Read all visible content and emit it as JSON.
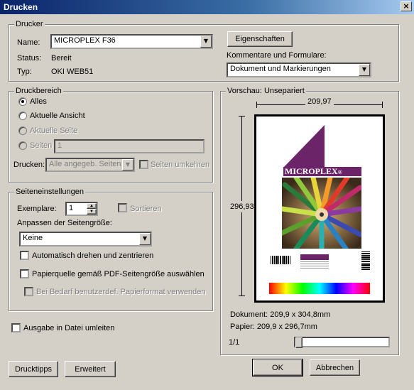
{
  "window": {
    "title": "Drucken",
    "close_glyph": "×"
  },
  "printer": {
    "group_title": "Drucker",
    "name_label": "Name:",
    "name_value": "MICROPLEX F36",
    "status_label": "Status:",
    "status_value": "Bereit",
    "type_label": "Typ:",
    "type_value": "OKI WEB51",
    "properties_button": "Eigenschaften",
    "comments_label": "Kommentare und Formulare:",
    "comments_value": "Dokument und Markierungen"
  },
  "print_range": {
    "group_title": "Druckbereich",
    "all_label": "Alles",
    "current_view_label": "Aktuelle Ansicht",
    "current_page_label": "Aktuelle Seite",
    "pages_label": "Seiten",
    "pages_value": "1",
    "print_label": "Drucken:",
    "print_value": "Alle angegeb. Seiten",
    "reverse_label": "Seiten umkehren"
  },
  "page_settings": {
    "group_title": "Seiteneinstellungen",
    "copies_label": "Exemplare:",
    "copies_value": "1",
    "collate_label": "Sortieren",
    "scaling_label": "Anpassen der Seitengröße:",
    "scaling_value": "Keine",
    "auto_rotate_label": "Automatisch drehen und zentrieren",
    "paper_source_label": "Papierquelle gemäß PDF-Seitengröße auswählen",
    "custom_paper_label": "Bei Bedarf benutzerdef. Papierformat verwenden"
  },
  "print_to_file_label": "Ausgabe in Datei umleiten",
  "preview": {
    "group_title": "Vorschau: Unsepariert",
    "width_dim": "209,97",
    "height_dim": "296,93",
    "logo_text": "MICRO",
    "logo_text_bold": "PLEX",
    "logo_reg": "®",
    "document_size": "Dokument: 209,9 x 304,8mm",
    "paper_size": "Papier: 209,9 x 296,7mm",
    "page_counter": "1/1"
  },
  "buttons": {
    "tips": "Drucktipps",
    "advanced": "Erweitert",
    "ok": "OK",
    "cancel": "Abbrechen"
  },
  "colors": {
    "logo_purple": "#6b2468",
    "titlebar": "#0a246a"
  }
}
